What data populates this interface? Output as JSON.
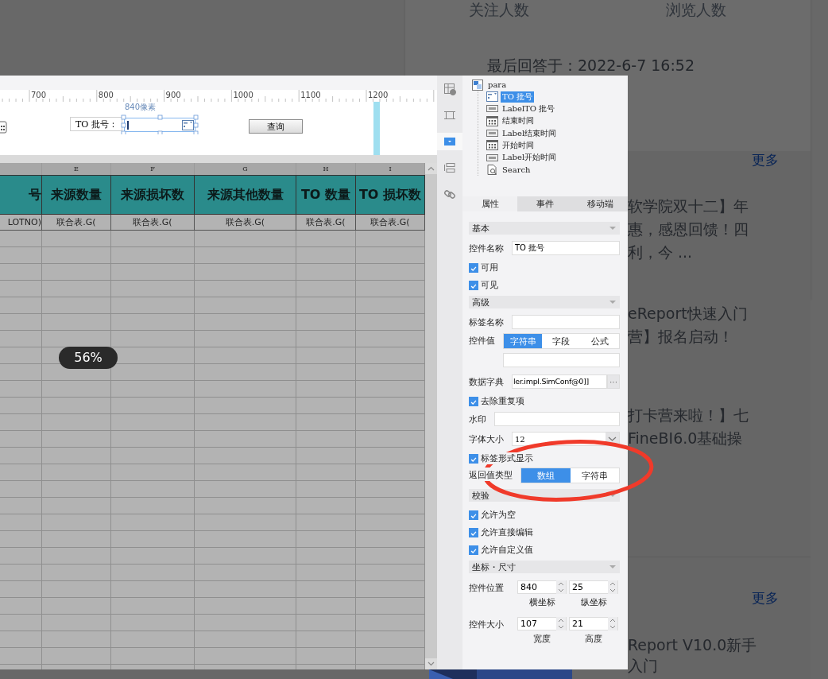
{
  "background": {
    "stats": [
      "关注人数",
      "浏览人数"
    ],
    "last_answer": "最后回答于：2022-6-7 16:52",
    "sections": [
      {
        "more": "更多",
        "items": [
          [
            "软学院双十二】年",
            "惠，感恩回馈！四",
            "利，今 ..."
          ],
          [
            "eReport快速入门",
            "营】报名启动！"
          ],
          [
            "打卡营来啦！】七",
            "FineBI6.0基础操"
          ]
        ]
      },
      {
        "more": "更多",
        "items": [
          [
            "Report V10.0新手",
            "入门"
          ]
        ]
      }
    ]
  },
  "designer": {
    "ruler": [
      "700",
      "800",
      "900",
      "1000",
      "1100",
      "1200"
    ],
    "canvas": {
      "position_hint": "840像素",
      "label": "TO 批号：",
      "button": "查询"
    },
    "sheet": {
      "columns": [
        {
          "header": "号",
          "cell": "LOTNO)"
        },
        {
          "letter": "E",
          "header": "来源数量",
          "cell": "联合表.G("
        },
        {
          "letter": "F",
          "header": "来源损坏数",
          "cell": "联合表.G("
        },
        {
          "letter": "G",
          "header": "来源其他数量",
          "cell": "联合表.G("
        },
        {
          "letter": "H",
          "header": "TO 数量",
          "cell": "联合表.G("
        },
        {
          "letter": "I",
          "header": "TO 损坏数",
          "cell": "联合表.G("
        }
      ]
    },
    "zoom": "56%"
  },
  "toolbar": [
    {
      "kind": "info",
      "selected": false
    },
    {
      "kind": "frame",
      "selected": false
    },
    {
      "kind": "combo",
      "selected": true
    },
    {
      "kind": "list",
      "selected": false
    },
    {
      "kind": "link",
      "selected": false
    }
  ],
  "tree": {
    "label": "para",
    "children": [
      {
        "label": "TO 批号",
        "kind": "combo",
        "selected": true
      },
      {
        "label": "LabelTO 批号",
        "kind": "label",
        "selected": false
      },
      {
        "label": "结束时间",
        "kind": "date",
        "selected": false
      },
      {
        "label": "Label结束时间",
        "kind": "label",
        "selected": false
      },
      {
        "label": "开始时间",
        "kind": "date",
        "selected": false
      },
      {
        "label": "Label开始时间",
        "kind": "label",
        "selected": false
      },
      {
        "label": "Search",
        "kind": "search",
        "selected": false
      }
    ]
  },
  "tabs": [
    {
      "label": "属性",
      "selected": true
    },
    {
      "label": "事件",
      "selected": false
    },
    {
      "label": "移动端",
      "selected": false
    }
  ],
  "properties": [
    {
      "kind": "section",
      "title": "基本"
    },
    {
      "kind": "text",
      "label": "控件名称",
      "value": "TO 批号"
    },
    {
      "kind": "check",
      "label": "可用",
      "checked": true
    },
    {
      "kind": "check",
      "label": "可见",
      "checked": true
    },
    {
      "kind": "section",
      "title": "高级"
    },
    {
      "kind": "text",
      "label": "标签名称"
    },
    {
      "kind": "segmented_field",
      "label": "控件值",
      "options": [
        {
          "label": "字符串",
          "selected": true
        },
        {
          "label": "字段",
          "selected": false
        },
        {
          "label": "公式",
          "selected": false
        }
      ]
    },
    {
      "kind": "dict",
      "label": "数据字典",
      "value": "ler.impl.SimConf@0]]",
      "button": "···"
    },
    {
      "kind": "check",
      "label": "去除重复项",
      "checked": true
    },
    {
      "kind": "text",
      "label": "水印"
    },
    {
      "kind": "select",
      "label": "字体大小",
      "value": "12"
    },
    {
      "kind": "check",
      "label": "标签形式显示",
      "checked": true
    },
    {
      "kind": "segmented",
      "label": "返回值类型",
      "options": [
        {
          "label": "数组",
          "selected": true
        },
        {
          "label": "字符串",
          "selected": false
        }
      ]
    },
    {
      "kind": "section",
      "title": "校验"
    },
    {
      "kind": "check",
      "label": "允许为空",
      "checked": true
    },
    {
      "kind": "check",
      "label": "允许直接编辑",
      "checked": true
    },
    {
      "kind": "check",
      "label": "允许自定义值",
      "checked": true
    },
    {
      "kind": "section",
      "title": "坐标・尺寸"
    },
    {
      "kind": "spin_pair",
      "label": "控件位置",
      "fields": [
        {
          "value": "840",
          "caption": "横坐标"
        },
        {
          "value": "25",
          "caption": "纵坐标"
        }
      ]
    },
    {
      "kind": "spin_pair",
      "label": "控件大小",
      "fields": [
        {
          "value": "107",
          "caption": "宽度"
        },
        {
          "value": "21",
          "caption": "高度"
        }
      ]
    }
  ]
}
